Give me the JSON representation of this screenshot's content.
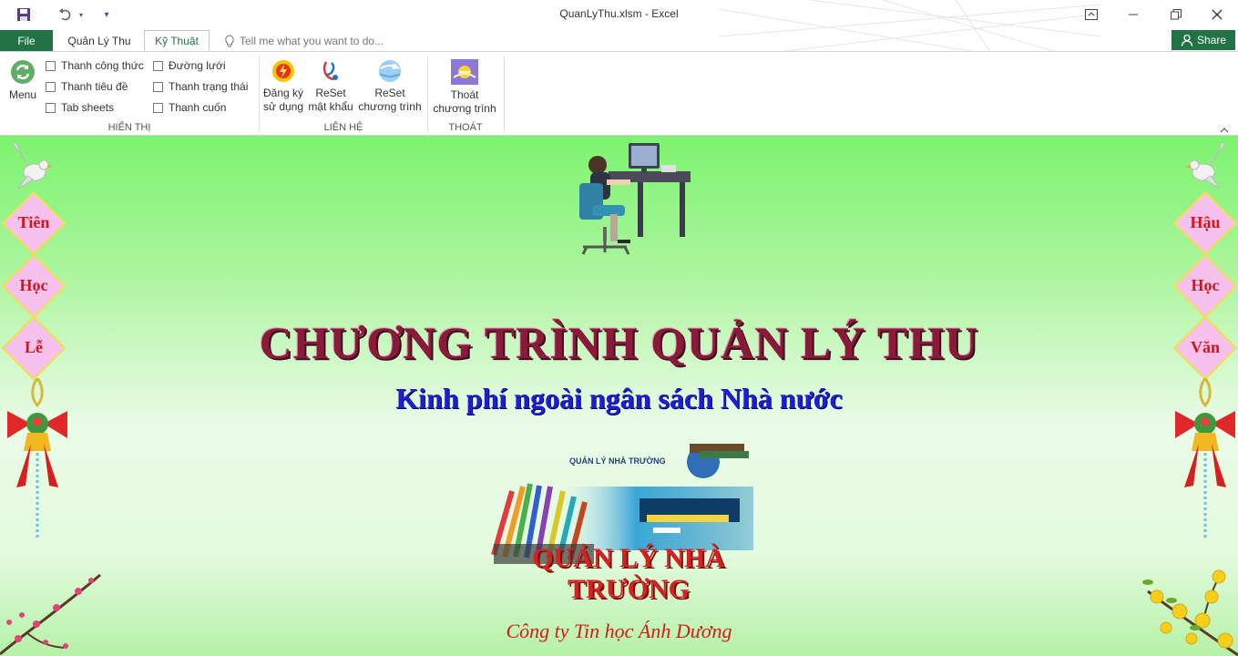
{
  "window": {
    "title": "QuanLyThu.xlsm - Excel",
    "quick_access": {
      "save_icon": "save-icon",
      "undo_icon": "undo-icon",
      "customize_icon": "customize-qat-icon"
    },
    "controls": [
      "ribbon-display-icon",
      "minimize-icon",
      "restore-icon",
      "close-icon"
    ]
  },
  "tabs": {
    "file": "File",
    "items": [
      {
        "label": "Quản Lý Thu",
        "active": false
      },
      {
        "label": "Kỹ Thuật",
        "active": true
      }
    ],
    "tell_me_placeholder": "Tell me what you want to do...",
    "share": "Share"
  },
  "ribbon": {
    "menu_label": "Menu",
    "hien_thi": {
      "label": "HIỂN THỊ",
      "checkboxes": [
        {
          "label": "Thanh công thức",
          "checked": false
        },
        {
          "label": "Thanh tiêu đề",
          "checked": false
        },
        {
          "label": "Tab sheets",
          "checked": false
        },
        {
          "label": "Đường lưới",
          "checked": false
        },
        {
          "label": "Thanh trạng thái",
          "checked": false
        },
        {
          "label": "Thanh cuốn",
          "checked": false
        }
      ]
    },
    "lien_he": {
      "label": "LIÊN HỆ",
      "buttons": [
        {
          "line1": "Đăng ký",
          "line2": "sử dụng"
        },
        {
          "line1": "ReSet",
          "line2": "mật khẩu"
        },
        {
          "line1": "ReSet",
          "line2": "chương trình"
        }
      ]
    },
    "thoat": {
      "label": "THOÁT",
      "button": {
        "line1": "Thoát",
        "line2": "chương trình"
      }
    }
  },
  "sheet": {
    "title": "CHƯƠNG TRÌNH QUẢN LÝ THU",
    "subtitle": "Kinh phí ngoài ngân sách Nhà nước",
    "logo_header": "QUẢN LÝ NHÀ TRƯỜNG",
    "logo_caption": "QUẢN LÝ NHÀ TRƯỜNG",
    "company": "Công ty Tin học Ánh Dương",
    "left_banner": [
      "Tiên",
      "Học",
      "Lễ"
    ],
    "right_banner": [
      "Hậu",
      "Học",
      "Văn"
    ]
  },
  "colors": {
    "excel_green": "#217346",
    "title": "#8a1a3a",
    "subtitle": "#1d1ed4",
    "company": "#d41a1a"
  }
}
